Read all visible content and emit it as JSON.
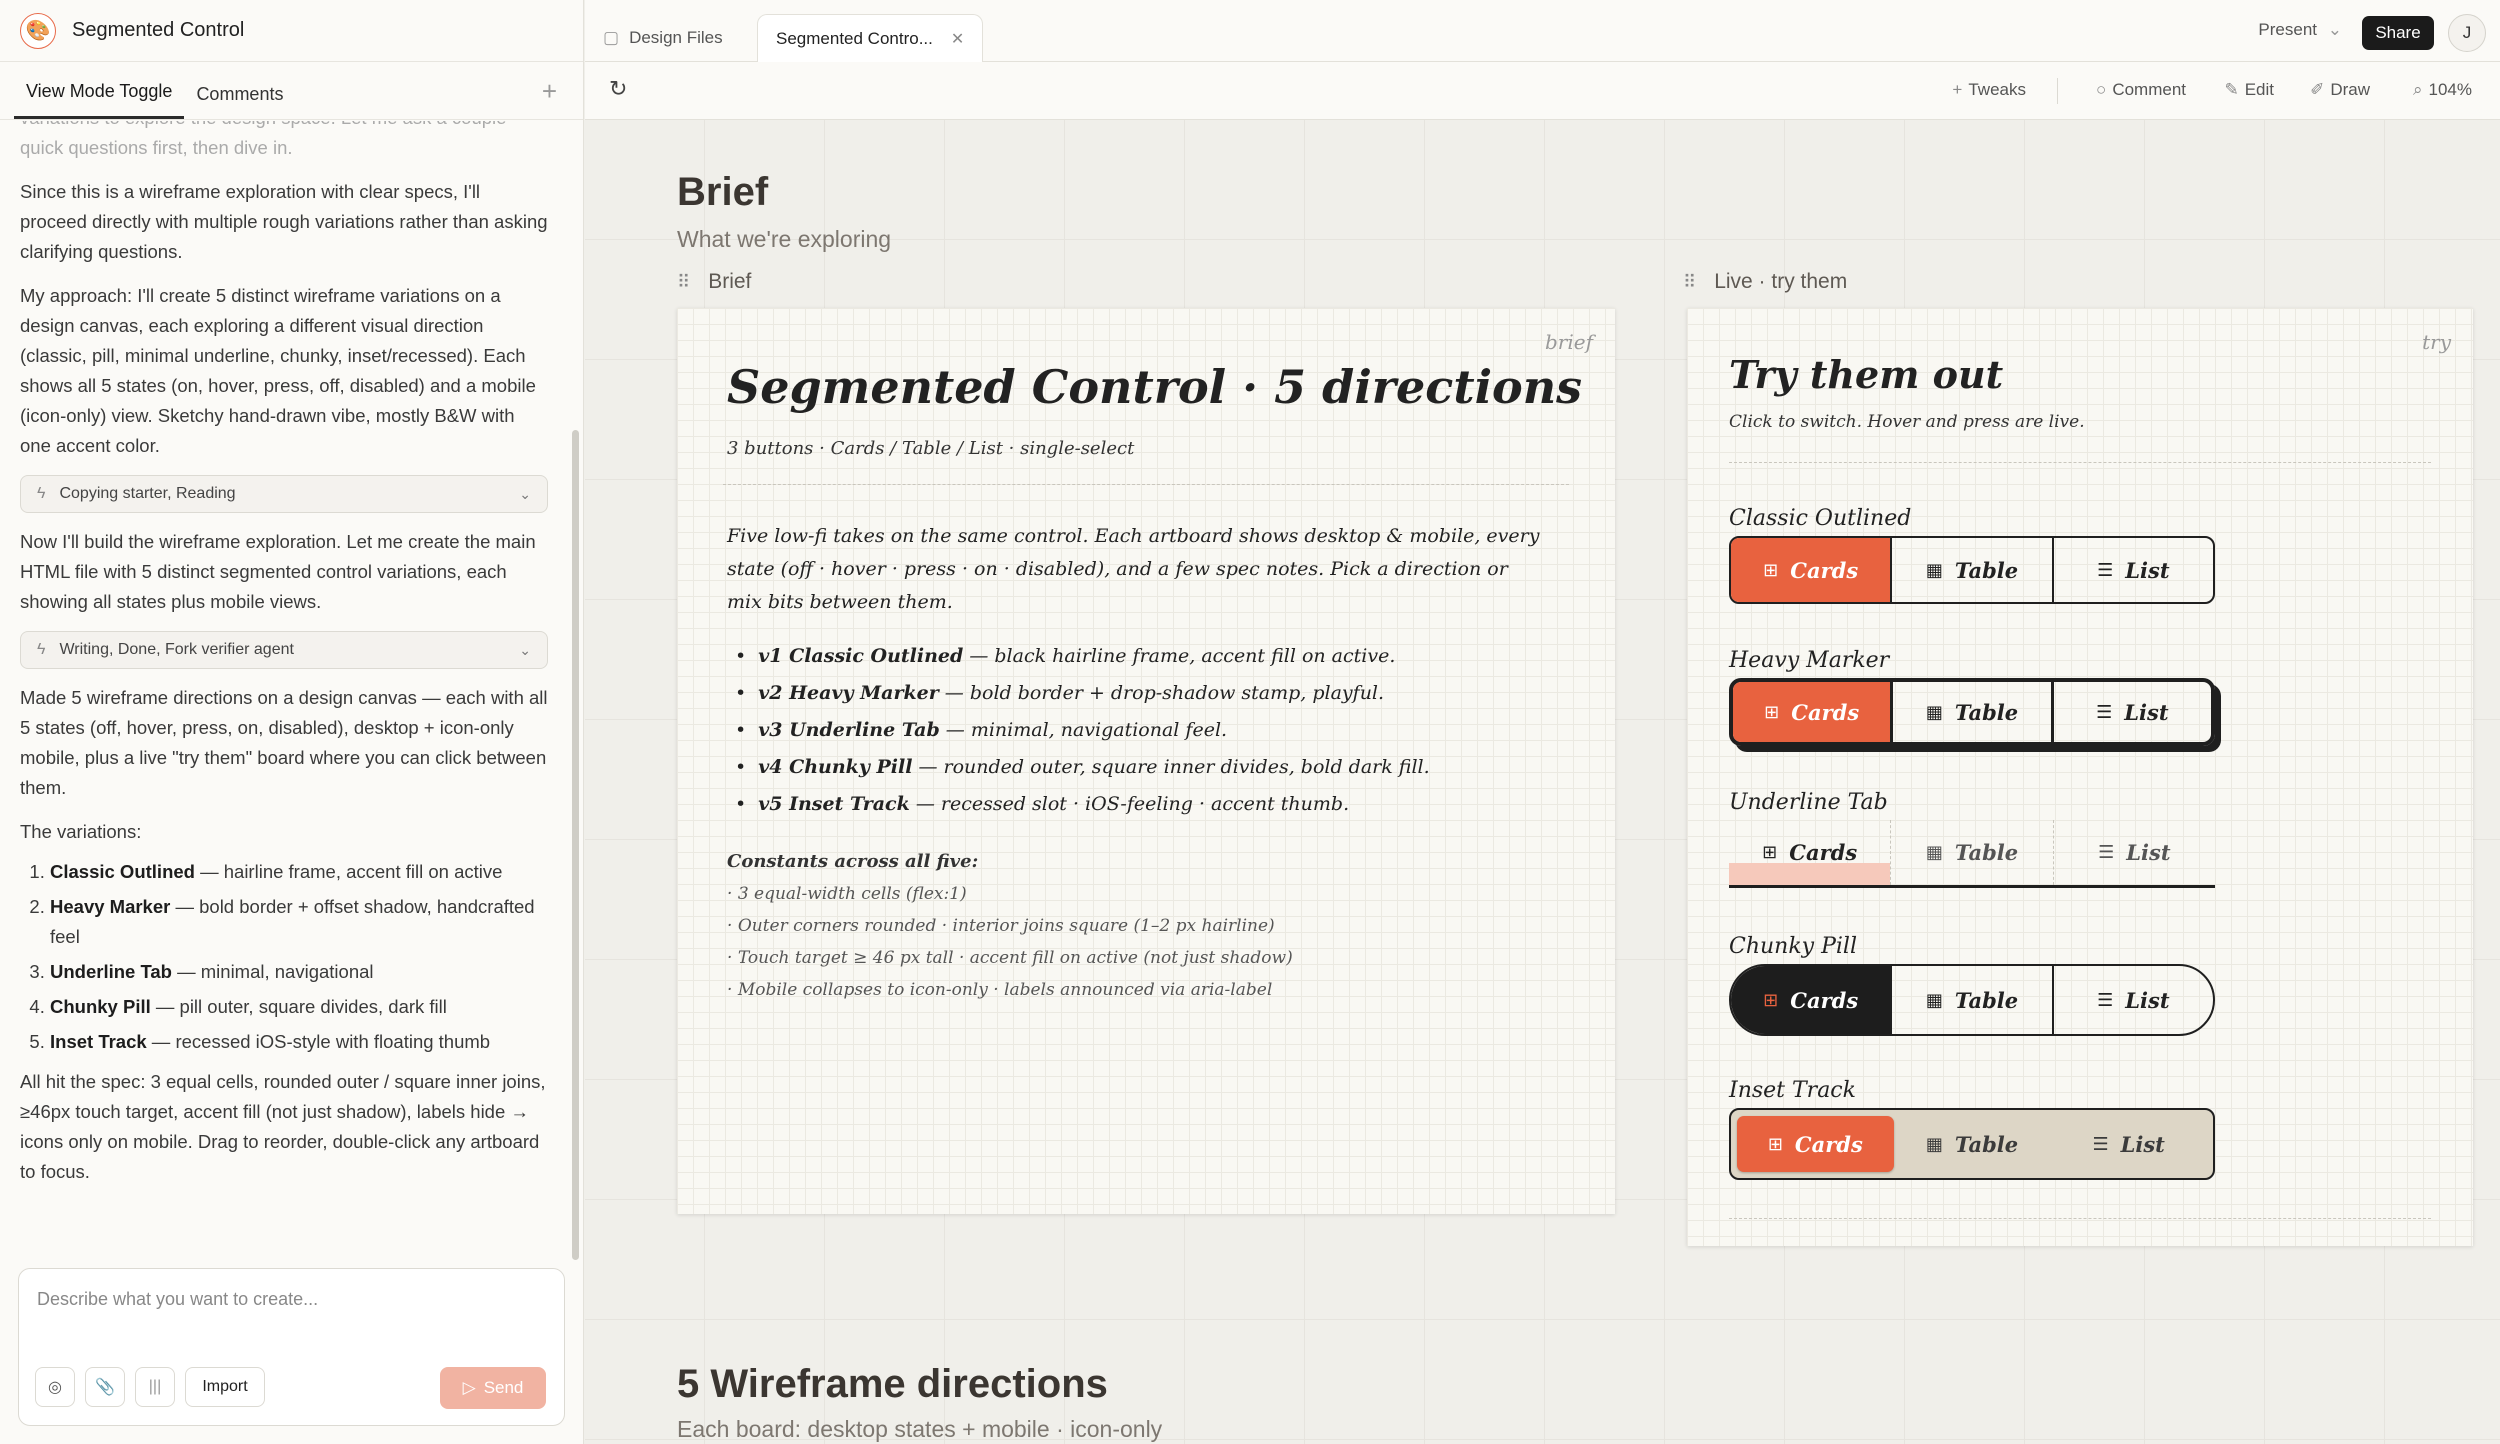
{
  "app": {
    "project_title": "Segmented Control",
    "logo_icon": "palette-icon"
  },
  "left_tabs": [
    "View Mode Toggle",
    "Comments"
  ],
  "chat": {
    "faded_line": "variations to explore the design space. Let me ask a couple quick questions first, then dive in.",
    "p1": "Since this is a wireframe exploration with clear specs, I'll proceed directly with multiple rough variations rather than asking clarifying questions.",
    "p2": "My approach: I'll create 5 distinct wireframe variations on a design canvas, each exploring a different visual direction (classic, pill, minimal underline, chunky, inset/recessed). Each shows all 5 states (on, hover, press, off, disabled) and a mobile (icon-only) view. Sketchy hand-drawn vibe, mostly B&W with one accent color.",
    "tool1": "Copying starter, Reading",
    "p3": "Now I'll build the wireframe exploration. Let me create the main HTML file with 5 distinct segmented control variations, each showing all states plus mobile views.",
    "tool2": "Writing, Done, Fork verifier agent",
    "p4": "Made 5 wireframe directions on a design canvas — each with all 5 states (off, hover, press, on, disabled), desktop + icon-only mobile, plus a live \"try them\" board where you can click between them.",
    "variations_intro": "The variations:",
    "variations": [
      {
        "name": "Classic Outlined",
        "desc": " — hairline frame, accent fill on active"
      },
      {
        "name": "Heavy Marker",
        "desc": " — bold border + offset shadow, handcrafted feel"
      },
      {
        "name": "Underline Tab",
        "desc": " — minimal, navigational"
      },
      {
        "name": "Chunky Pill",
        "desc": " — pill outer, square divides, dark fill"
      },
      {
        "name": "Inset Track",
        "desc": " — recessed iOS-style with floating thumb"
      }
    ],
    "p5": "All hit the spec: 3 equal cells, rounded outer / square inner joins, ≥46px touch target, accent fill (not just shadow), labels hide → icons only on mobile. Drag to reorder, double-click any artboard to focus."
  },
  "composer": {
    "placeholder": "Describe what you want to create...",
    "import_label": "Import",
    "send_label": "Send"
  },
  "file_tabs": {
    "design_files": "Design Files",
    "current": "Segmented Contro..."
  },
  "header_right": {
    "present": "Present",
    "share": "Share",
    "avatar": "J"
  },
  "toolbar": {
    "tweaks": "Tweaks",
    "comment": "Comment",
    "edit": "Edit",
    "draw": "Draw",
    "zoom": "104%"
  },
  "canvas": {
    "brief_title": "Brief",
    "brief_sub": "What we're exploring",
    "brief_label": "Brief",
    "live_label": "Live · try them",
    "wire_title": "5 Wireframe directions",
    "wire_sub": "Each board: desktop states + mobile · icon-only"
  },
  "brief_board": {
    "tag": "brief",
    "title": "Segmented Control · 5 directions",
    "sub": "3 buttons · Cards / Table / List · single-select",
    "intro": "Five low-fi takes on the same control. Each artboard shows desktop & mobile, every state (off · hover · press · on · disabled), and a few spec notes. Pick a direction or mix bits between them.",
    "items": [
      {
        "name": "v1 Classic Outlined",
        "desc": " — black hairline frame, accent fill on active."
      },
      {
        "name": "v2 Heavy Marker",
        "desc": " — bold border + drop-shadow stamp, playful."
      },
      {
        "name": "v3 Underline Tab",
        "desc": " — minimal, navigational feel."
      },
      {
        "name": "v4 Chunky Pill",
        "desc": " — rounded outer, square inner divides, bold dark fill."
      },
      {
        "name": "v5 Inset Track",
        "desc": " — recessed slot · iOS-feeling · accent thumb."
      }
    ],
    "constants_title": "Constants across all five:",
    "constants": [
      "3 equal-width cells (flex:1)",
      "Outer corners rounded · interior joins square (1–2 px hairline)",
      "Touch target ≥ 46 px tall · accent fill on active (not just shadow)",
      "Mobile collapses to icon-only · labels announced via aria-label"
    ]
  },
  "live_board": {
    "tag": "try",
    "title": "Try them out",
    "sub": "Click to switch. Hover and press are live.",
    "segment_labels": [
      "Cards",
      "Table",
      "List"
    ],
    "segment_icons": [
      "cards-icon",
      "table-icon",
      "list-icon"
    ],
    "variants": [
      "Classic Outlined",
      "Heavy Marker",
      "Underline Tab",
      "Chunky Pill",
      "Inset Track"
    ]
  },
  "colors": {
    "accent": "#e8623f",
    "ink": "#1f1f1f",
    "paper": "#f9f8f3",
    "canvas": "#f0efea"
  }
}
